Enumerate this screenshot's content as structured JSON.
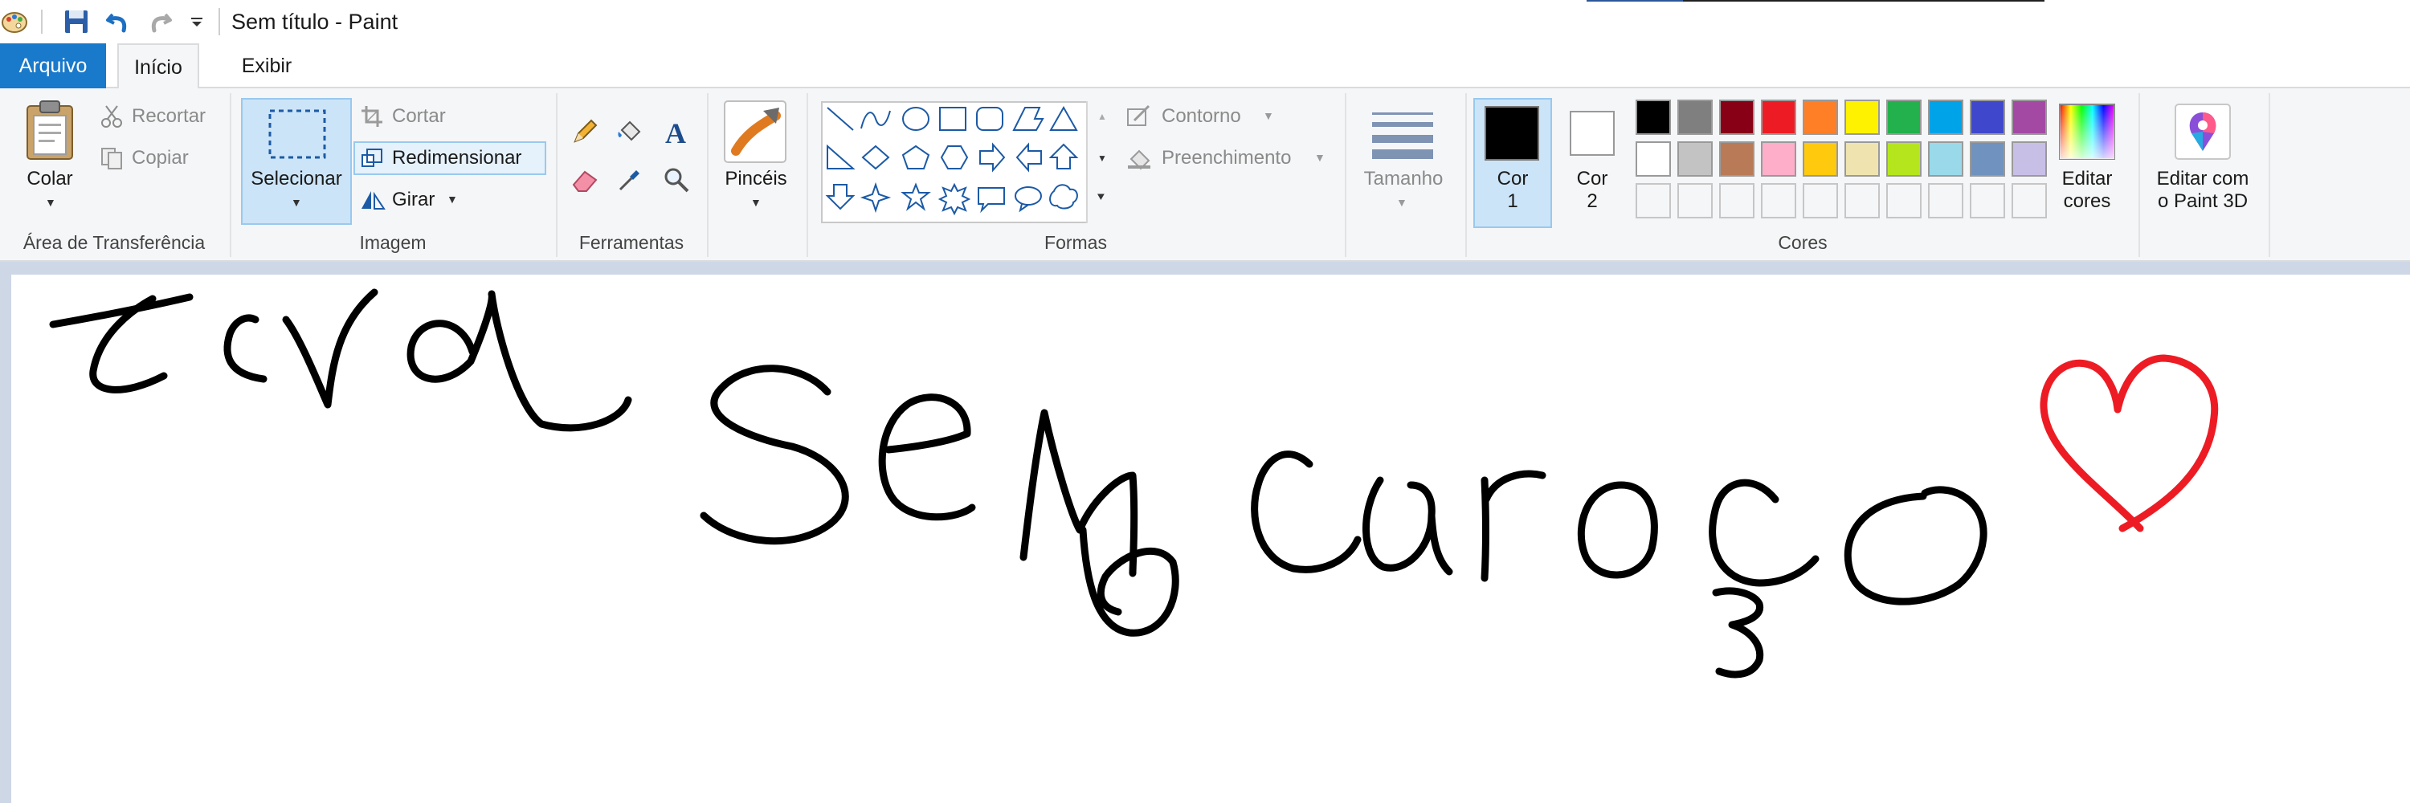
{
  "window": {
    "title": "Sem título - Paint"
  },
  "tabs": {
    "file": "Arquivo",
    "home": "Início",
    "view": "Exibir"
  },
  "ribbon": {
    "clipboard": {
      "paste": "Colar",
      "cut": "Recortar",
      "copy": "Copiar",
      "group": "Área de Transferência"
    },
    "image": {
      "select": "Selecionar",
      "crop": "Cortar",
      "resize": "Redimensionar",
      "rotate": "Girar",
      "group": "Imagem"
    },
    "tools": {
      "group": "Ferramentas"
    },
    "brushes": {
      "label": "Pincéis"
    },
    "shapes": {
      "outline": "Contorno",
      "fill": "Preenchimento",
      "group": "Formas"
    },
    "size": {
      "label": "Tamanho"
    },
    "colors": {
      "color1_line1": "Cor",
      "color1_line2": "1",
      "color2_line1": "Cor",
      "color2_line2": "2",
      "edit_line1": "Editar",
      "edit_line2": "cores",
      "paint3d_line1": "Editar com",
      "paint3d_line2": "o Paint 3D",
      "group": "Cores",
      "color1_value": "#000000",
      "color2_value": "#ffffff",
      "palette": [
        "#000000",
        "#7f7f7f",
        "#880015",
        "#ed1c24",
        "#ff7f27",
        "#fff200",
        "#22b14c",
        "#00a2e8",
        "#3f48cc",
        "#a349a4",
        "#ffffff",
        "#c3c3c3",
        "#b97a57",
        "#ffaec9",
        "#ffc90e",
        "#efe4b0",
        "#b5e61d",
        "#99d9ea",
        "#7092be",
        "#c8bfe7"
      ]
    }
  },
  "canvas": {
    "drawing": "handwritten doodle: wave-like scribble, the words 'Sem caroço' in black marker and a red heart"
  }
}
